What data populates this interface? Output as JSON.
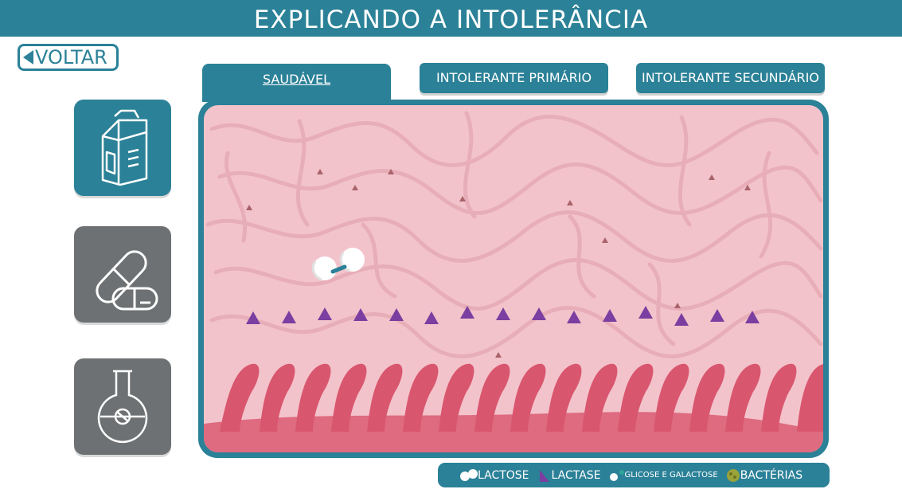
{
  "header": {
    "title": "EXPLICANDO A INTOLERÂNCIA"
  },
  "nav": {
    "back_label": "VOLTAR"
  },
  "sidebar": {
    "items": [
      {
        "name": "milk-carton-icon",
        "state": "active"
      },
      {
        "name": "pill-capsule-icon",
        "state": "inactive"
      },
      {
        "name": "lab-flask-icon",
        "state": "inactive"
      }
    ]
  },
  "tabs": [
    {
      "label": "SAUDÁVEL",
      "active": true
    },
    {
      "label": "INTOLERANTE PRIMÁRIO",
      "active": false
    },
    {
      "label": "INTOLERANTE SECUNDÁRIO",
      "active": false
    }
  ],
  "legend": {
    "lactose": "LACTOSE",
    "lactase": "LACTASE",
    "glicose": "GLICOSE E GALACTOSE",
    "bacterias": "BACTÉRIAS"
  },
  "colors": {
    "primary": "#2b8197",
    "inactive": "#6e7173",
    "tissue": "#f3c3cb",
    "villi": "#d9566f",
    "lactase": "#7a3fa0"
  }
}
